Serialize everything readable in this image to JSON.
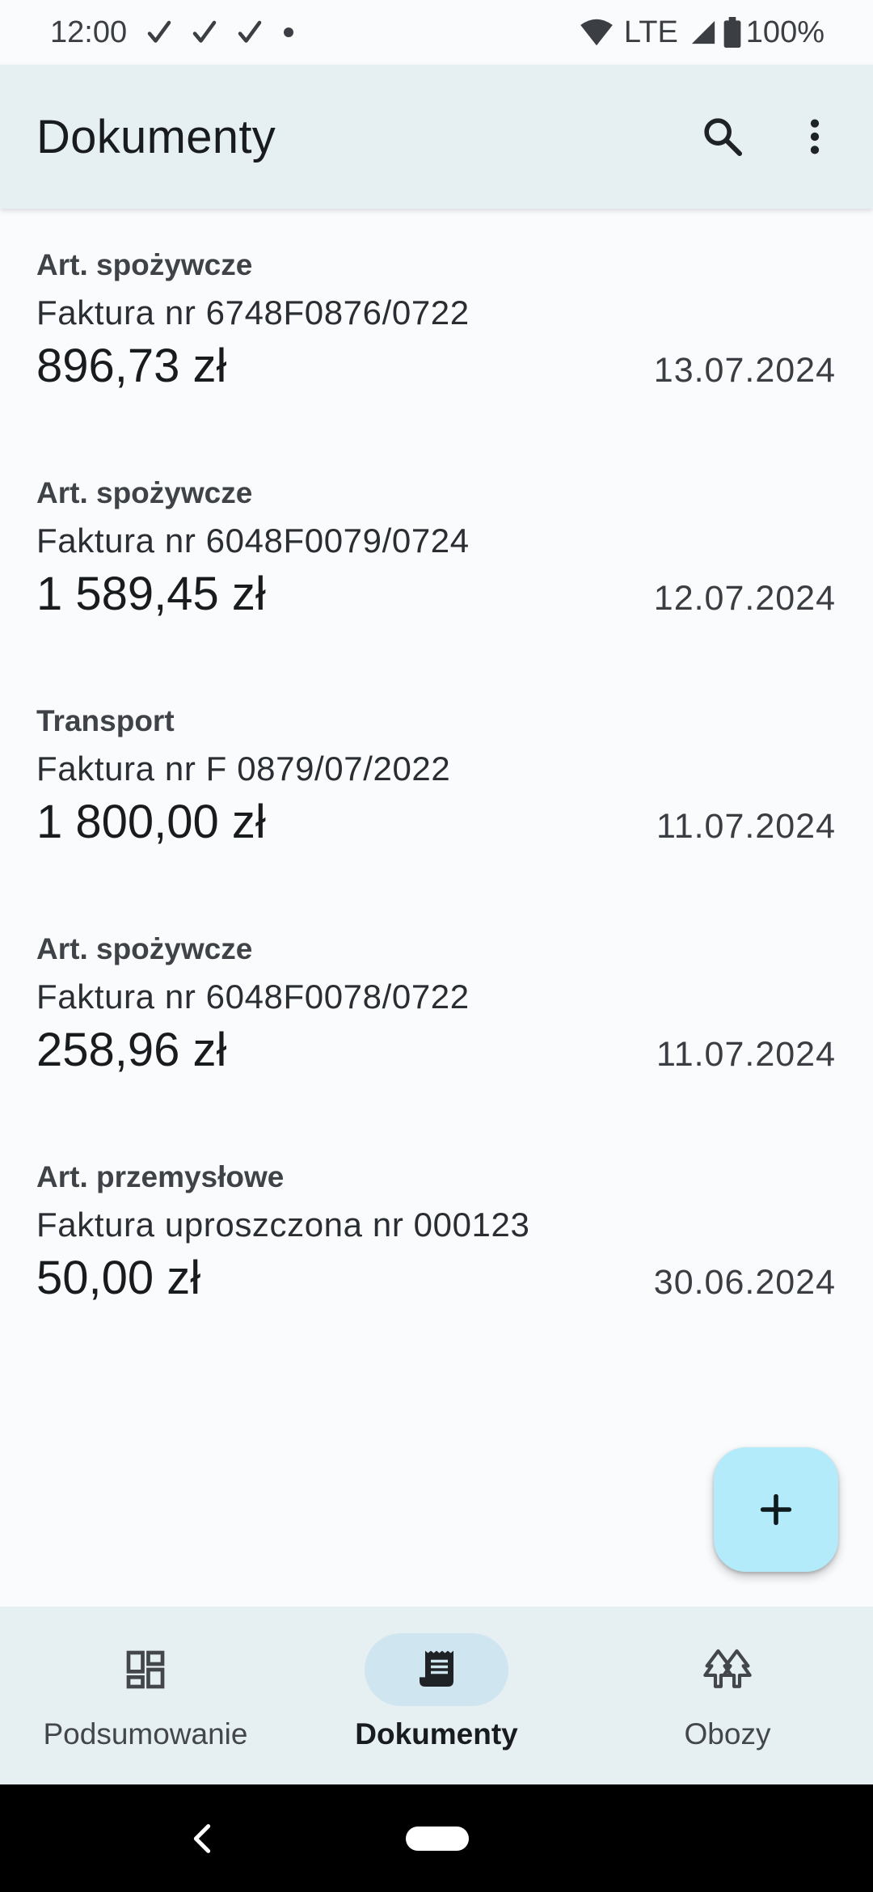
{
  "status_bar": {
    "time": "12:00",
    "network": "LTE",
    "battery": "100%"
  },
  "app_bar": {
    "title": "Dokumenty",
    "actions": [
      "search-icon",
      "more-vert-icon"
    ]
  },
  "documents": [
    {
      "category": "Art. spożywcze",
      "title": "Faktura nr 6748F0876/0722",
      "amount": "896,73 zł",
      "date": "13.07.2024"
    },
    {
      "category": "Art. spożywcze",
      "title": "Faktura nr 6048F0079/0724",
      "amount": "1 589,45 zł",
      "date": "12.07.2024"
    },
    {
      "category": "Transport",
      "title": "Faktura nr F 0879/07/2022",
      "amount": "1 800,00 zł",
      "date": "11.07.2024"
    },
    {
      "category": "Art. spożywcze",
      "title": "Faktura nr 6048F0078/0722",
      "amount": "258,96 zł",
      "date": "11.07.2024"
    },
    {
      "category": "Art. przemysłowe",
      "title": "Faktura uproszczona nr 000123",
      "amount": "50,00 zł",
      "date": "30.06.2024"
    }
  ],
  "fab": {
    "icon": "add-icon"
  },
  "bottom_nav": {
    "items": [
      {
        "label": "Podsumowanie",
        "icon": "dashboard-icon",
        "active": false
      },
      {
        "label": "Dokumenty",
        "icon": "receipt-icon",
        "active": true
      },
      {
        "label": "Obozy",
        "icon": "forest-icon",
        "active": false
      }
    ]
  },
  "colors": {
    "background": "#f9fbfd",
    "app_bar": "#e6eff1",
    "fab": "#b3ebfa",
    "nav_active_pill": "#cfe6f0"
  }
}
